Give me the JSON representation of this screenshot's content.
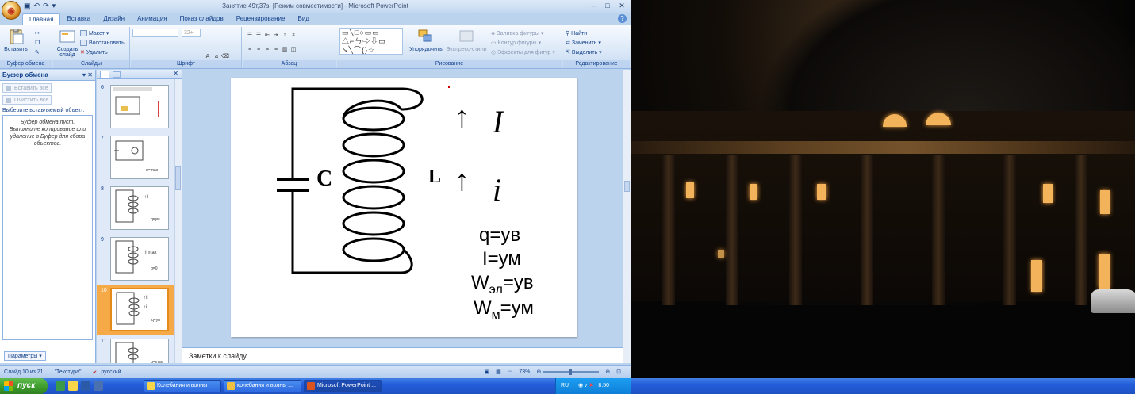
{
  "window": {
    "title": "Занятие 49т,37з. [Режим совместимости] - Microsoft PowerPoint",
    "tabs": [
      "Главная",
      "Вставка",
      "Дизайн",
      "Анимация",
      "Показ слайдов",
      "Рецензирование",
      "Вид"
    ],
    "active_tab": "Главная"
  },
  "ribbon": {
    "clipboard": {
      "paste": "Вставить",
      "title": "Буфер обмена"
    },
    "slides": {
      "create": "Создать",
      "create2": "слайд",
      "layout": "Макет",
      "restore": "Восстановить",
      "delete": "Удалить",
      "title": "Слайды"
    },
    "font": {
      "size": "32+",
      "title": "Шрифт"
    },
    "paragraph": {
      "title": "Абзац"
    },
    "drawing": {
      "arrange": "Упорядочить",
      "quick_styles": "Экспресс-стили",
      "fill": "Заливка фигуры",
      "outline": "Контур фигуры",
      "effects": "Эффекты для фигур",
      "title": "Рисование"
    },
    "editing": {
      "find": "Найти",
      "replace": "Заменить",
      "select": "Выделить",
      "title": "Редактирование"
    }
  },
  "clipboard_pane": {
    "title": "Буфер обмена",
    "paste_all": "Вставить все",
    "clear_all": "Очистить все",
    "select_label": "Выберите вставляемый объект:",
    "empty_message": "Буфер обмена пуст. Выполните копирование или удаление в Буфер для сбора объектов.",
    "params": "Параметры"
  },
  "slides_pane": {
    "items": [
      {
        "num": "6"
      },
      {
        "num": "7"
      },
      {
        "num": "8"
      },
      {
        "num": "9"
      },
      {
        "num": "10",
        "selected": true
      },
      {
        "num": "11"
      }
    ]
  },
  "slide": {
    "capacitor": "C",
    "inductor": "L",
    "arrow": "↑",
    "current_big": "I",
    "current_small": "i",
    "eq1": "q=ув",
    "eq2": "I=ум",
    "eq3_main": "W",
    "eq3_sub": "эл",
    "eq3_rest": "=ув",
    "eq4_main": "W",
    "eq4_sub": "м",
    "eq4_rest": "=ум"
  },
  "notes_placeholder": "Заметки к слайду",
  "status": {
    "slide_info": "Слайд 10 из 21",
    "theme": "\"Текстура\"",
    "language": "русский",
    "zoom": "73%"
  },
  "taskbar": {
    "start": "пуск",
    "items": [
      {
        "label": "Колебания и волны"
      },
      {
        "label": "колебания и волны ..."
      },
      {
        "label": "Microsoft PowerPoint ...",
        "active": true
      }
    ],
    "lang": "RU",
    "clock": "8:50"
  },
  "colors": {
    "ribbon_blue": "#15428b",
    "selection_orange": "#f5a947",
    "taskbar_blue": "#245edb",
    "start_green": "#3c9a2b"
  }
}
